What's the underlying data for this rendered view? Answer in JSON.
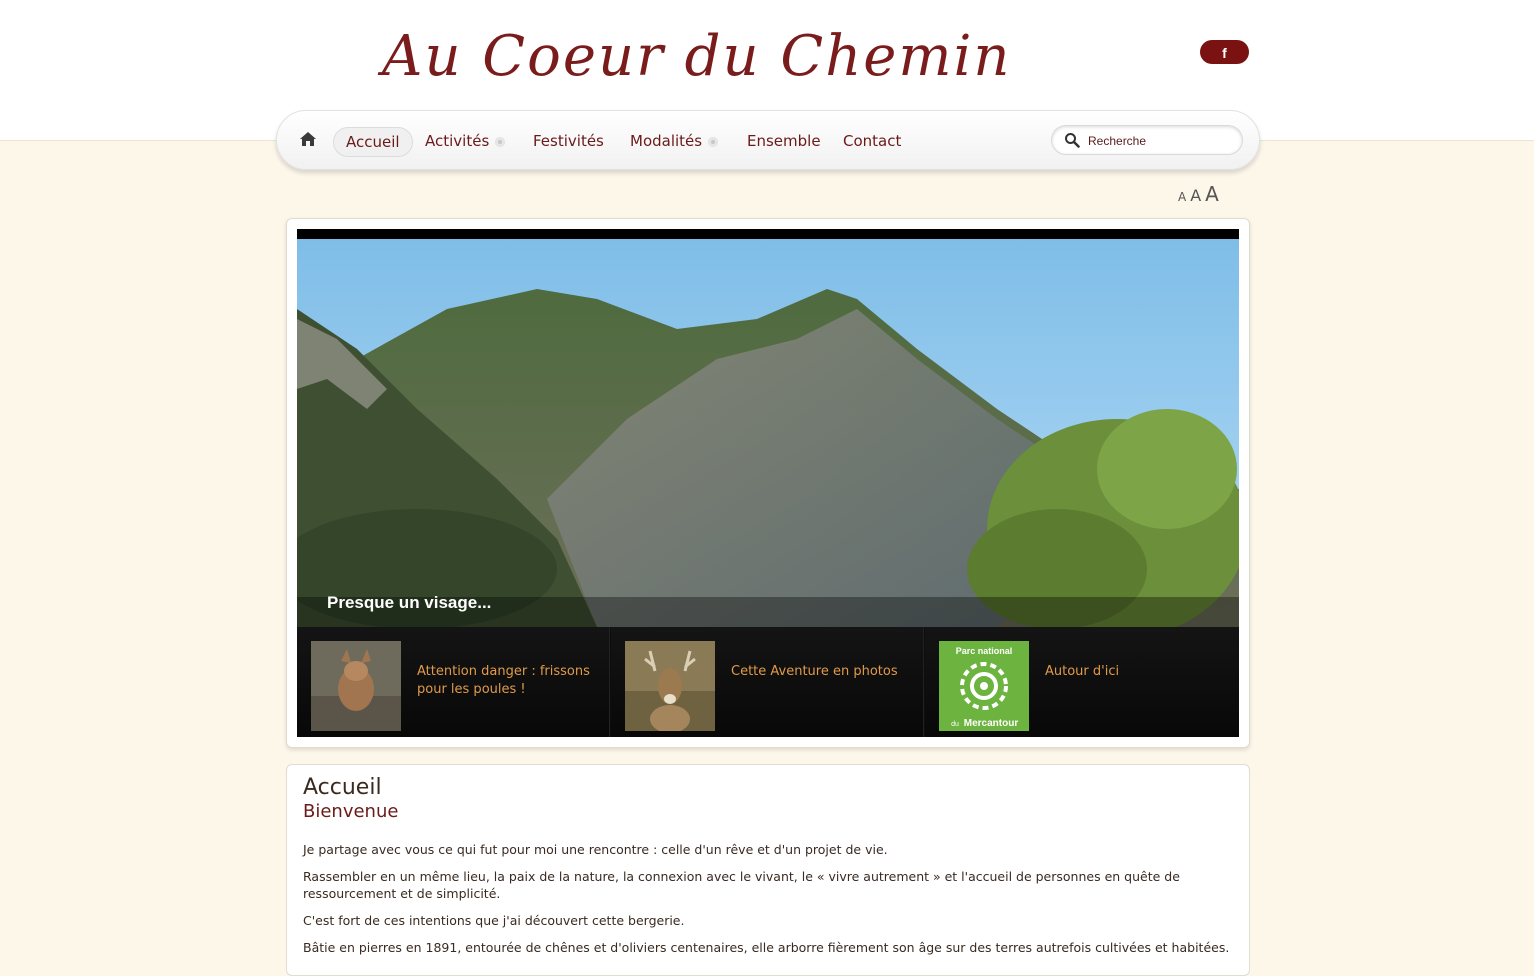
{
  "site": {
    "logo_text": "Au Coeur du Chemin",
    "facebook_label": "f"
  },
  "nav": {
    "items": [
      {
        "label": "Accueil",
        "active": true,
        "has_submenu": false
      },
      {
        "label": "Activités",
        "active": false,
        "has_submenu": true
      },
      {
        "label": "Festivités",
        "active": false,
        "has_submenu": false
      },
      {
        "label": "Modalités",
        "active": false,
        "has_submenu": true
      },
      {
        "label": "Ensemble",
        "active": false,
        "has_submenu": false
      },
      {
        "label": "Contact",
        "active": false,
        "has_submenu": false
      }
    ],
    "search_placeholder": "Recherche"
  },
  "font_size_controls": [
    "A",
    "A",
    "A"
  ],
  "slider": {
    "caption": "Presque un visage...",
    "thumbs": [
      {
        "label": "Attention danger : frissons pour les poules !",
        "icon": "fox-photo"
      },
      {
        "label": "Cette Aventure en photos",
        "icon": "deer-photo"
      },
      {
        "label": "Autour d'ici",
        "icon": "parc-mercantour-logo",
        "logo_top": "Parc national",
        "logo_bottom_prefix": "du",
        "logo_bottom": "Mercantour"
      }
    ]
  },
  "article": {
    "title": "Accueil",
    "subtitle": "Bienvenue",
    "paragraphs": [
      "Je partage avec vous ce qui fut pour moi une rencontre : celle d'un rêve et d'un projet de vie.",
      "Rassembler en un même lieu, la paix de la nature, la connexion avec le vivant, le « vivre autrement » et l'accueil de personnes en quête de ressourcement et de simplicité.",
      "C'est fort de ces intentions que j'ai découvert cette bergerie.",
      "Bâtie en pierres en 1891, entourée de chênes et d'oliviers centenaires, elle arborre fièrement son âge sur des terres autrefois cultivées et habitées."
    ]
  },
  "colors": {
    "brand": "#7a1c1c",
    "thumb_text": "#e09a4a",
    "background": "#fdf7ea"
  }
}
